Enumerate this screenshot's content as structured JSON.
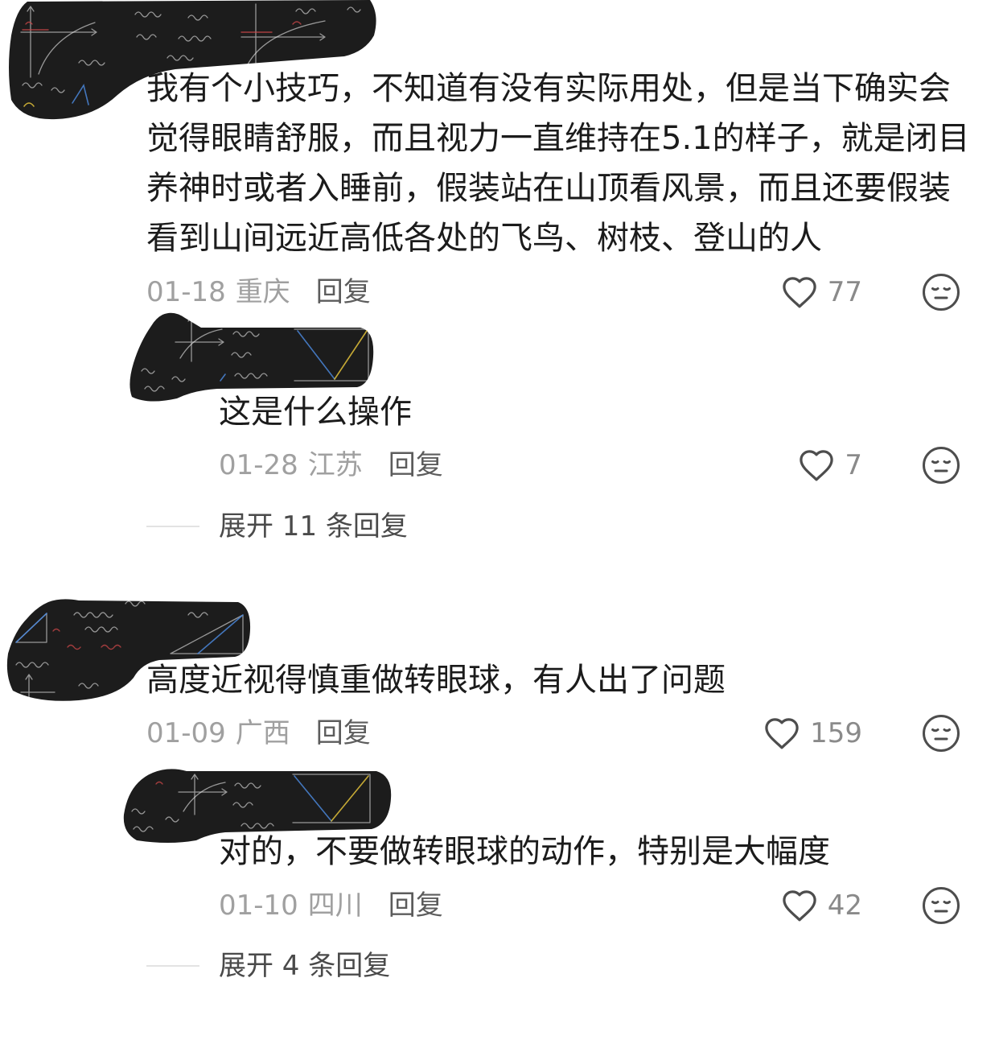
{
  "colors": {
    "background": "#ffffff",
    "text": "#1b1b1b",
    "meta": "#a0a0a0",
    "reply_action": "#5c5c5c",
    "like_count": "#8a8a8a",
    "expand": "#4a4a4a",
    "divider": "#e3e3e3",
    "icon": "#4d4d4d",
    "redaction": "#1c1c1c"
  },
  "icons": {
    "like": "heart-icon",
    "dislike": "expressionless-face-icon"
  },
  "comments": [
    {
      "text_lines": [
        "我有个小技巧，不知道有没有实际用处，但是当下确实会",
        "觉得眼睛舒服，而且视力一直维持在5.1的样子，就是闭目",
        "养神时或者入睡前，假装站在山顶看风景，而且还要假装",
        "看到山间远近高低各处的飞鸟、树枝、登山的人"
      ],
      "date": "01-18",
      "location": "重庆",
      "reply_action": "回复",
      "likes": "77",
      "reply": {
        "text": "这是什么操作",
        "date": "01-28",
        "location": "江苏",
        "reply_action": "回复",
        "likes": "7"
      },
      "expand_label": "展开 11 条回复"
    },
    {
      "text_lines": [
        "高度近视得慎重做转眼球，有人出了问题"
      ],
      "date": "01-09",
      "location": "广西",
      "reply_action": "回复",
      "likes": "159",
      "reply": {
        "text": "对的，不要做转眼球的动作，特别是大幅度",
        "date": "01-10",
        "location": "四川",
        "reply_action": "回复",
        "likes": "42"
      },
      "expand_label": "展开 4 条回复"
    }
  ]
}
